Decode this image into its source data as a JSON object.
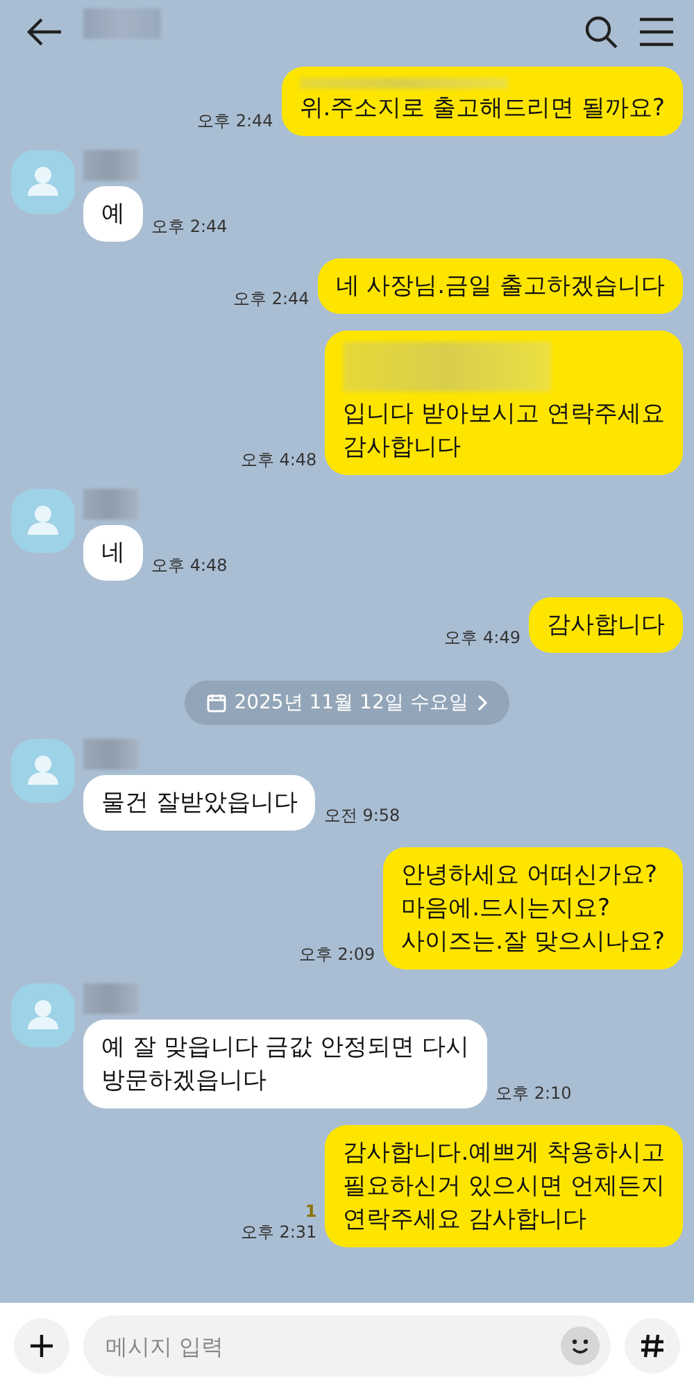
{
  "input": {
    "placeholder": "메시지 입력"
  },
  "messages": [
    {
      "kind": "sent",
      "redacted": true,
      "text": "위.주소지로 출고해드리면 될까요?",
      "time": "오후 2:44"
    },
    {
      "kind": "received",
      "text": "예",
      "time": "오후 2:44"
    },
    {
      "kind": "sent",
      "redacted": false,
      "text": "네 사장님.금일 출고하겠습니다",
      "time": "오후 2:44"
    },
    {
      "kind": "sent",
      "redacted": true,
      "text": "입니다 받아보시고 연락주세요\n감사합니다",
      "time": "오후 4:48"
    },
    {
      "kind": "received",
      "text": "네",
      "time": "오후 4:48"
    },
    {
      "kind": "sent",
      "redacted": false,
      "text": "감사합니다",
      "time": "오후 4:49"
    },
    {
      "kind": "date",
      "text": "2025년 11월 12일 수요일"
    },
    {
      "kind": "received",
      "text": "물건 잘받았읍니다",
      "time": "오전 9:58"
    },
    {
      "kind": "sent",
      "redacted": false,
      "text": "안녕하세요 어떠신가요?\n마음에.드시는지요?\n사이즈는.잘 맞으시나요?",
      "time": "오후 2:09"
    },
    {
      "kind": "received",
      "text": "예 잘 맞읍니다  금값  안정되면 다시\n방문하겠읍니다",
      "time": "오후 2:10"
    },
    {
      "kind": "sent",
      "redacted": false,
      "text": "감사합니다.예쁘게 착용하시고\n필요하신거 있으시면 언제든지\n연락주세요 감사합니다",
      "time": "오후 2:31",
      "unread": "1"
    }
  ]
}
